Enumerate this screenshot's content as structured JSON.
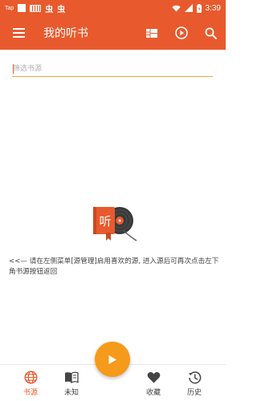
{
  "status_bar": {
    "tap_text": "Tap",
    "glyph_1": "虫",
    "glyph_2": "虫",
    "time": "3:39"
  },
  "app_bar": {
    "title": "我的听书"
  },
  "search": {
    "placeholder": "筛选书源"
  },
  "empty_state": {
    "illustration_text": "听",
    "message": "<<— 请在左侧菜单[源管理]启用喜欢的源, 进入源后可再次点击左下角书源按钮返回"
  },
  "bottom_nav": {
    "items": [
      {
        "label": "书源",
        "icon": "globe-icon",
        "active": true
      },
      {
        "label": "未知",
        "icon": "book-icon",
        "active": false
      },
      {
        "label": "收藏",
        "icon": "heart-icon",
        "active": false
      },
      {
        "label": "历史",
        "icon": "history-icon",
        "active": false
      }
    ]
  },
  "colors": {
    "primary": "#e85a2d",
    "accent": "#f59a1b",
    "underline": "#e9a64a"
  }
}
